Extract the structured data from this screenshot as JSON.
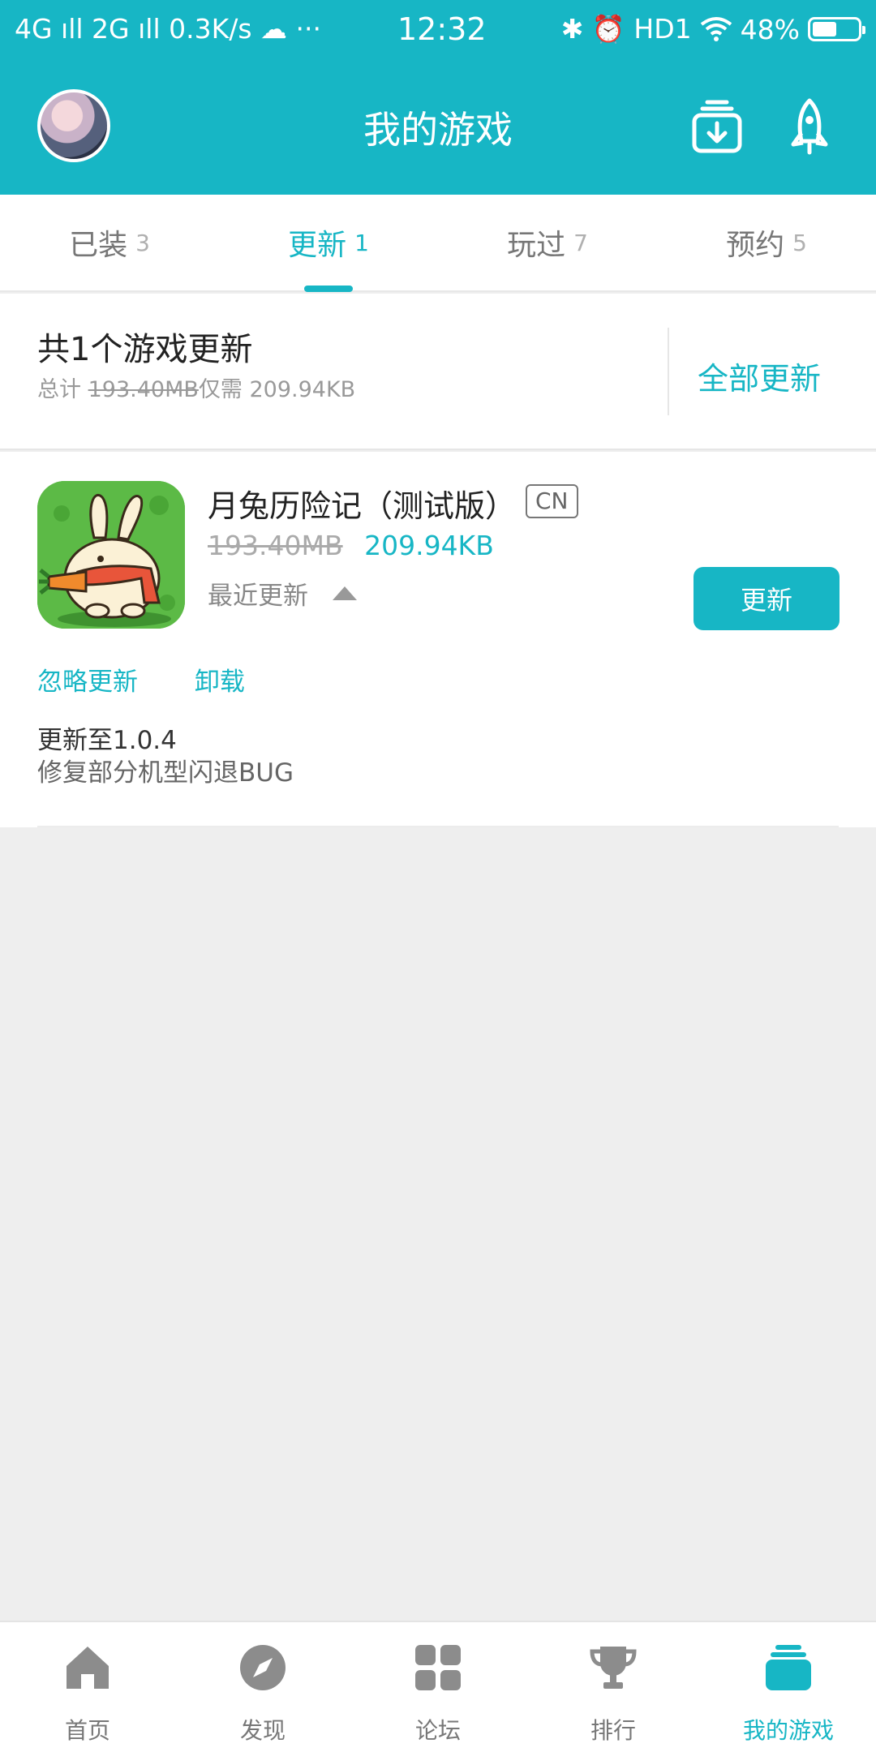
{
  "status_bar": {
    "left": "4G ıll 2G ıll 0.3K/s ☁ ···",
    "time": "12:32",
    "right": "✱ ⏰ HD1",
    "battery": "48%"
  },
  "header": {
    "title": "我的游戏"
  },
  "tabs": [
    {
      "label": "已装",
      "count": "3"
    },
    {
      "label": "更新",
      "count": "1"
    },
    {
      "label": "玩过",
      "count": "7"
    },
    {
      "label": "预约",
      "count": "5"
    }
  ],
  "summary": {
    "heading": "共1个游戏更新",
    "total_label": "总计",
    "original_size": "193.40MB",
    "only_label": "仅需",
    "patch_size": "209.94KB",
    "update_all": "全部更新"
  },
  "game": {
    "name": "月兔历险记（测试版）",
    "region": "CN",
    "old_size": "193.40MB",
    "new_size": "209.94KB",
    "recent_label": "最近更新",
    "update_button": "更新",
    "ignore_link": "忽略更新",
    "uninstall_link": "卸载",
    "note_line1": "更新至1.0.4",
    "note_line2": "修复部分机型闪退BUG"
  },
  "bottom_nav": [
    {
      "label": "首页"
    },
    {
      "label": "发现"
    },
    {
      "label": "论坛"
    },
    {
      "label": "排行"
    },
    {
      "label": "我的游戏"
    }
  ],
  "colors": {
    "accent": "#17b6c5",
    "icon_gray": "#8c8c8c"
  }
}
